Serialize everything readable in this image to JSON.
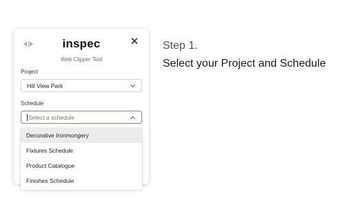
{
  "panel": {
    "brand": "inspec",
    "subtitle": "Web Clipper Tool",
    "icons": {
      "drag": "drag-handle-icon",
      "close": "close-icon"
    }
  },
  "project": {
    "label": "Project",
    "value": "Hill View Park"
  },
  "schedule": {
    "label": "Schedule",
    "placeholder": "Select a schedule",
    "options": [
      "Decorative Ironmongery",
      "Fixtures Schedule",
      "Product Catalogue",
      "Finishes Schedule"
    ]
  },
  "instructions": {
    "step": "Step 1.",
    "description": "Select your Project and Schedule"
  },
  "colors": {
    "focus_border": "#6f88c9",
    "hover_option": "#ececec"
  }
}
